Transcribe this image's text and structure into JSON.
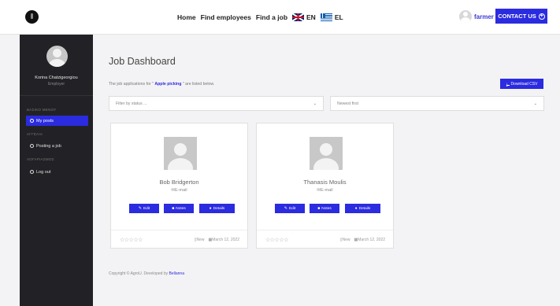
{
  "nav": {
    "home": "Home",
    "find_employees": "Find employees",
    "find_job": "Find a job",
    "lang_en": "EN",
    "lang_el": "EL",
    "username": "farmer",
    "contact": "CONTACT US",
    "contact_icon": "+"
  },
  "sidebar": {
    "name": "Korina Chatzigeorgiou",
    "role": "Employer",
    "sections": [
      {
        "heading": "ΒΑΣΙΚΟ ΜΕΝΟΥ",
        "item": "My posts",
        "active": true
      },
      {
        "heading": "ΑΓΓΕΛΙΑ",
        "item": "Posting a job",
        "active": false
      },
      {
        "heading": "ΛΟΓΑΡΙΑΣΜΟΣ",
        "item": "Log out",
        "active": false
      }
    ]
  },
  "main": {
    "title": "Job Dashboard",
    "subtitle_pre": "The job applications for \" ",
    "subtitle_job": "Apple picking",
    "subtitle_post": " \" are listed below.",
    "download_csv": "Download CSV",
    "filter_status_placeholder": "Filter by status ...",
    "sort_selected": "Newest first"
  },
  "cards": [
    {
      "name": "Bob Bridgerton",
      "email": "E-mail",
      "edit": "Edit",
      "notes": "Notes",
      "details": "Details",
      "stars": "☆☆☆☆☆",
      "status": "New",
      "date": "March 12, 2022"
    },
    {
      "name": "Thanasis Moulis",
      "email": "E-mail",
      "edit": "Edit",
      "notes": "Notes",
      "details": "Details",
      "stars": "☆☆☆☆☆",
      "status": "New",
      "date": "March 12, 2022"
    }
  ],
  "footer": {
    "text": "Copyright © AgroU. Developed by ",
    "link": "Bellanna"
  },
  "colors": {
    "accent": "#2b2be0",
    "sidebar_bg": "#222226",
    "page_bg": "#f3f3f5"
  }
}
